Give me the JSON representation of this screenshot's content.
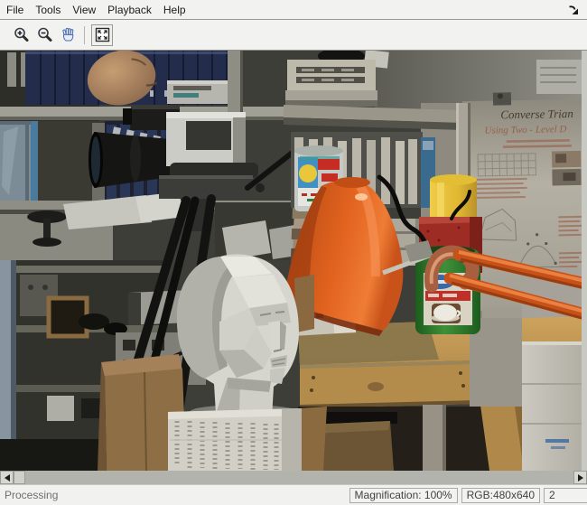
{
  "menu": {
    "items": [
      "File",
      "Tools",
      "View",
      "Playback",
      "Help"
    ]
  },
  "window": {
    "dock_icon": "dock-arrow-icon"
  },
  "toolbar": {
    "buttons": [
      {
        "name": "zoom-in",
        "icon": "magnifier-plus-icon"
      },
      {
        "name": "zoom-out",
        "icon": "magnifier-minus-icon"
      },
      {
        "name": "pan",
        "icon": "hand-icon"
      },
      {
        "name": "maintain-fit-to-window",
        "icon": "fit-to-window-icon"
      }
    ]
  },
  "viewer": {
    "image_description": "Lab scene: white plaster bust, orange articulated desk lamp, video camera on tripod, bookshelves with blue binders, cans, poster and wooden table",
    "poster": {
      "line1": "Converse Trian",
      "line2": "Using Two - Level D"
    }
  },
  "scrollbar": {
    "orientation": "horizontal",
    "icons": [
      "left-triangle",
      "right-triangle"
    ]
  },
  "status_bar": {
    "message": "Processing",
    "cells": [
      "Magnification: 100%",
      "RGB:480x640",
      "2"
    ]
  },
  "colors": {
    "chrome": "#f1f1ee",
    "lamp_orange": "#d4581c",
    "table_wood": "#c89e58",
    "can_green": "#2e7c2e",
    "can_yellow": "#e2be34",
    "binder_blue": "#2a3656"
  }
}
